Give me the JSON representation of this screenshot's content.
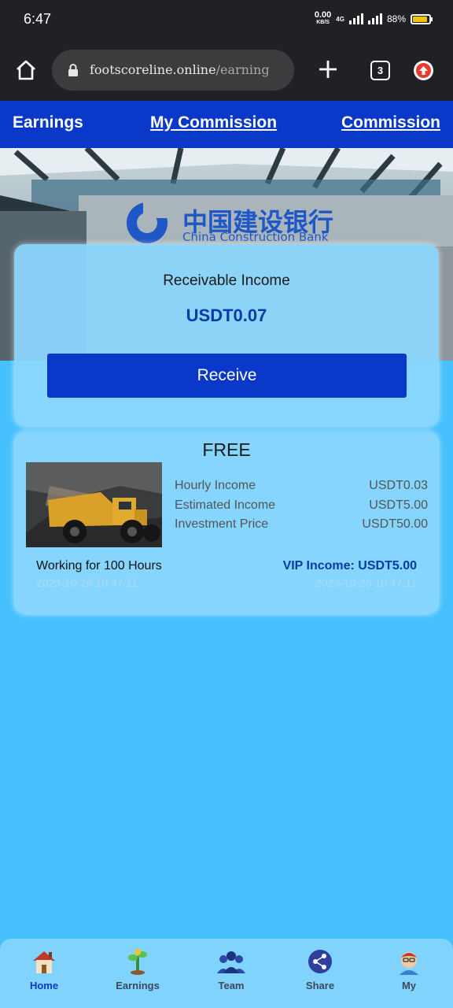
{
  "status": {
    "time": "6:47",
    "net_speed": "0.00",
    "net_unit": "KB/S",
    "net_type": "4G",
    "battery": "88%"
  },
  "browser": {
    "url_host": "footscoreline.online",
    "url_path": "/earning",
    "tab_count": "3"
  },
  "top_nav": {
    "earnings": "Earnings",
    "my_commission": "My Commission",
    "commission": "Commission"
  },
  "hero": {
    "bank_name_cn": "中国建设银行",
    "bank_name_en": "China Construction Bank"
  },
  "income": {
    "label": "Receivable Income",
    "amount": "USDT0.07",
    "button": "Receive"
  },
  "product": {
    "title": "FREE",
    "stats": [
      {
        "label": "Hourly Income",
        "value": "USDT0.03"
      },
      {
        "label": "Estimated Income",
        "value": "USDT5.00"
      },
      {
        "label": "Investment Price",
        "value": "USDT50.00"
      }
    ],
    "working": "Working for 100 Hours",
    "vip_income": "VIP Income: USDT5.00",
    "start_time": "2023-10-26 10:47:11",
    "end_time": "2023-10-26 10:47:11"
  },
  "bottom_nav": [
    {
      "label": "Home",
      "icon": "house-icon"
    },
    {
      "label": "Earnings",
      "icon": "money-plant-icon"
    },
    {
      "label": "Team",
      "icon": "team-icon"
    },
    {
      "label": "Share",
      "icon": "share-icon"
    },
    {
      "label": "My",
      "icon": "avatar-icon"
    }
  ],
  "colors": {
    "primary": "#0a38c8",
    "background": "#46c0fe",
    "card": "#8cd7ff",
    "accent_text": "#0a3aa8"
  }
}
